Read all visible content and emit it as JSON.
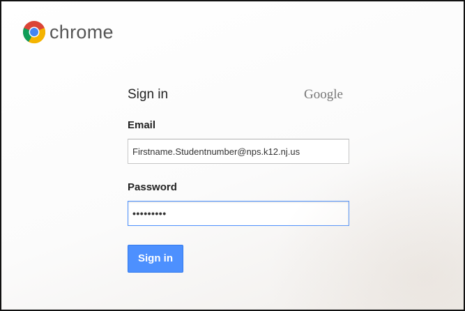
{
  "header": {
    "brand": "chrome"
  },
  "form": {
    "title": "Sign in",
    "provider": "Google",
    "email_label": "Email",
    "email_value": "Firstname.Studentnumber@nps.k12.nj.us",
    "password_label": "Password",
    "password_mask": "•••••••••",
    "submit_label": "Sign in"
  },
  "icons": {
    "logo": "chrome-logo-icon"
  },
  "colors": {
    "button": "#4d90fe",
    "button_border": "#3079ed",
    "focus": "#4d90fe"
  }
}
